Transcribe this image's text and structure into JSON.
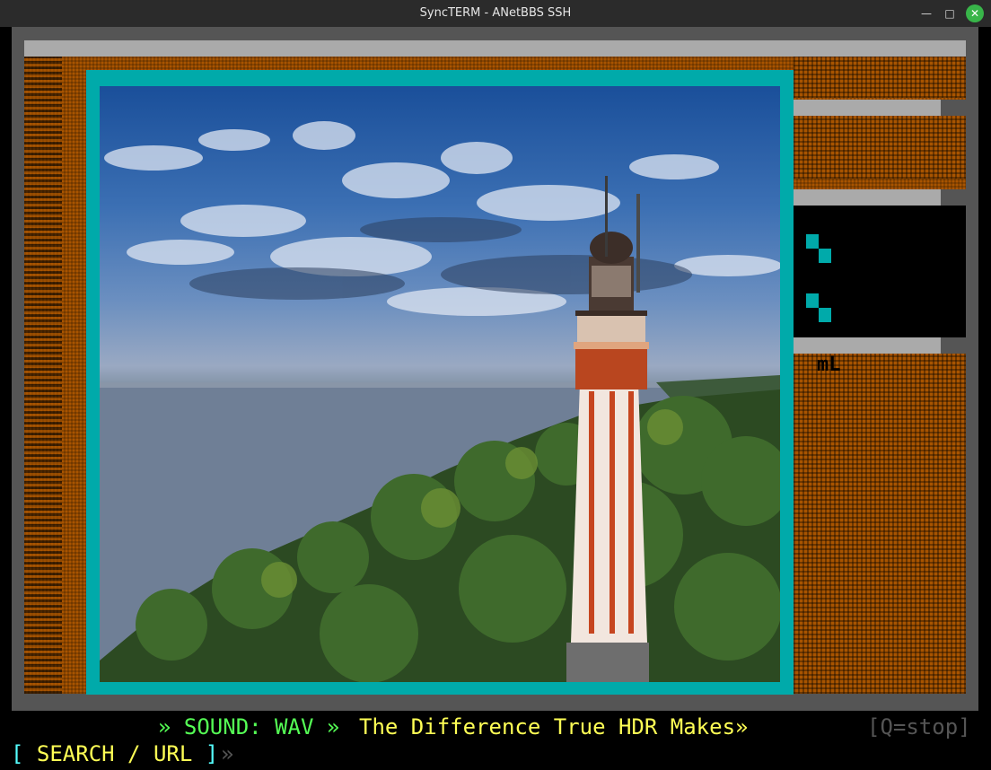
{
  "window": {
    "title": "SyncTERM - ANetBBS SSH",
    "min_glyph": "—",
    "max_glyph": "□",
    "close_glyph": "✕"
  },
  "status": {
    "sound_label": "» SOUND: WAV »",
    "song_title": "The Difference True HDR Makes»",
    "stop_hint": "[Q=stop]"
  },
  "prompt": {
    "open_bracket": "[",
    "label": " SEARCH / URL ",
    "close_bracket": "]",
    "arrow": "»"
  },
  "side": {
    "mark": "mL"
  },
  "colors": {
    "frame": "#00aaaa",
    "orange": "#a85400",
    "green": "#55ff55",
    "yellow": "#ffff55",
    "cyan": "#55ffff"
  }
}
